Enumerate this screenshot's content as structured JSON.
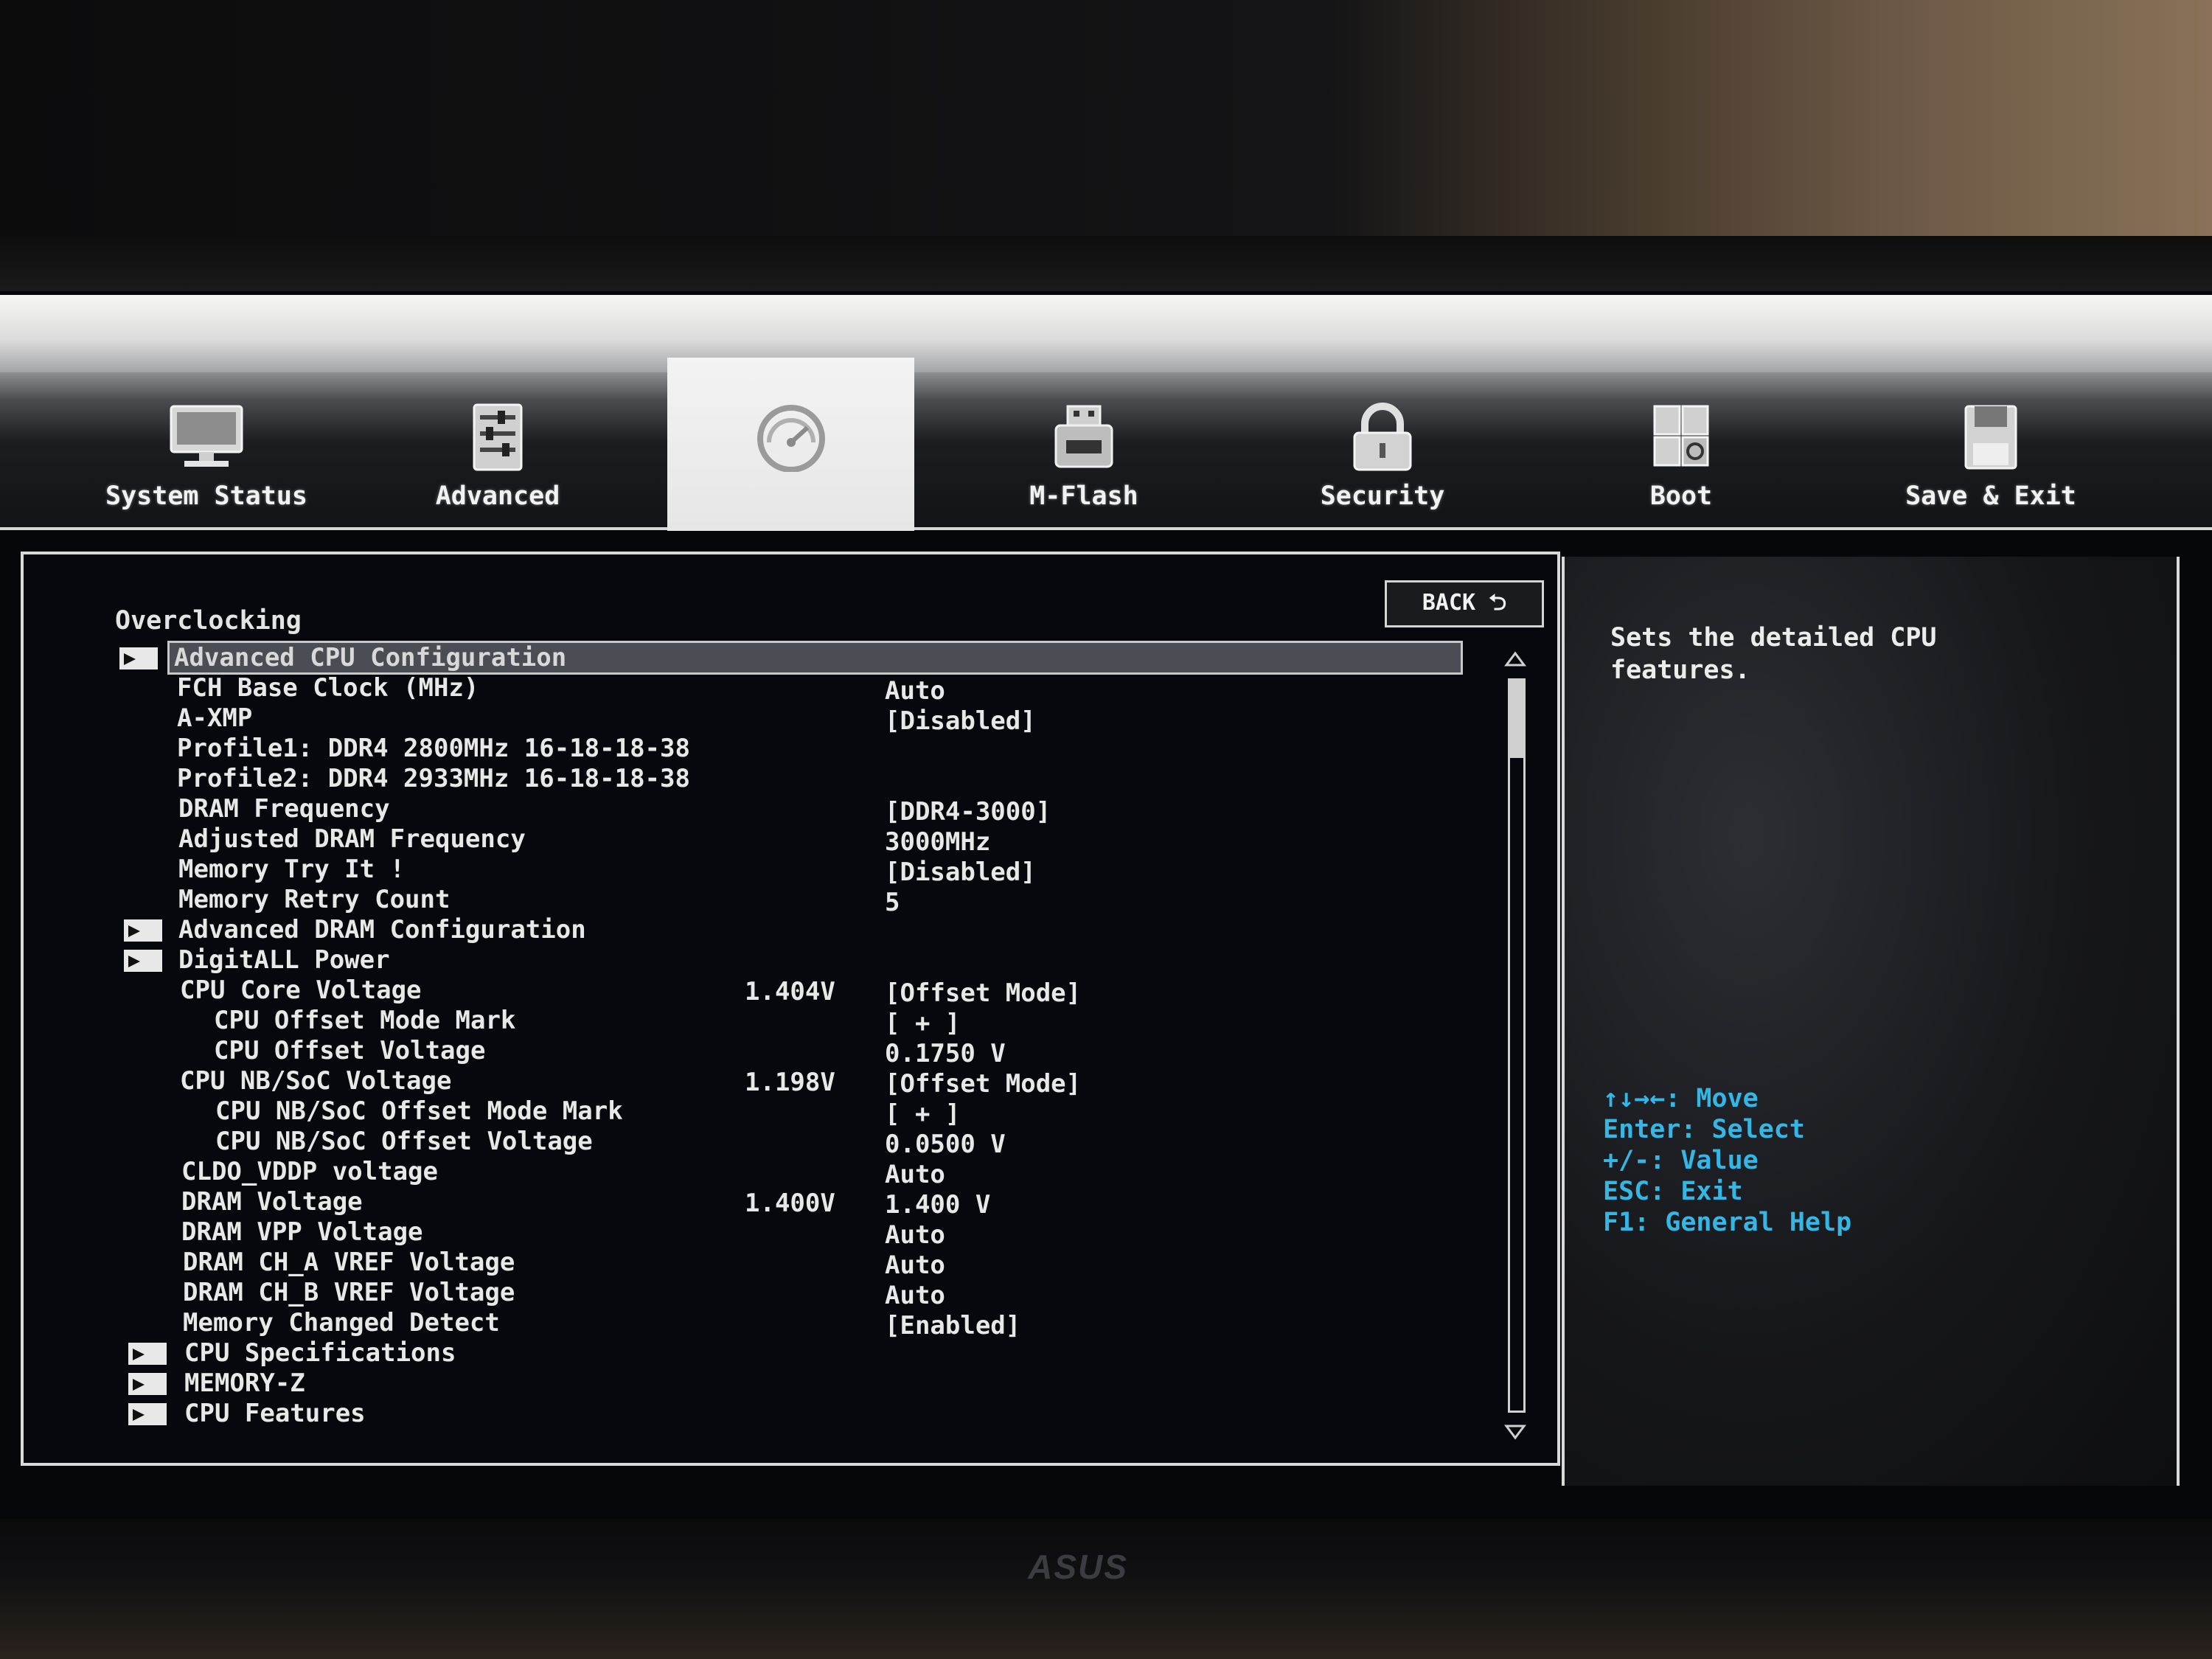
{
  "header": {
    "tabs": [
      {
        "label": "System Status",
        "icon": "monitor-icon"
      },
      {
        "label": "Advanced",
        "icon": "sliders-icon"
      },
      {
        "label": "",
        "icon": "gauge-icon",
        "active": true
      },
      {
        "label": "M-Flash",
        "icon": "usb-bios-icon"
      },
      {
        "label": "Security",
        "icon": "lock-icon"
      },
      {
        "label": "Boot",
        "icon": "boot-grid-icon"
      },
      {
        "label": "Save & Exit",
        "icon": "floppy-icon"
      }
    ]
  },
  "main": {
    "title": "Overclocking",
    "back_label": "BACK ⮌",
    "rows": [
      {
        "name": "Advanced CPU Configuration",
        "reading": "",
        "value": "",
        "folder": true,
        "selected": true,
        "indent": 0
      },
      {
        "name": "FCH Base Clock (MHz)",
        "reading": "",
        "value": "Auto",
        "indent": 0
      },
      {
        "name": "A-XMP",
        "reading": "",
        "value": "[Disabled]",
        "indent": 0
      },
      {
        "name": "Profile1: DDR4 2800MHz 16-18-18-38",
        "reading": "",
        "value": "",
        "indent": 0
      },
      {
        "name": "Profile2: DDR4 2933MHz 16-18-18-38",
        "reading": "",
        "value": "",
        "indent": 0
      },
      {
        "name": "DRAM Frequency",
        "reading": "",
        "value": "[DDR4-3000]",
        "indent": 0
      },
      {
        "name": "Adjusted DRAM Frequency",
        "reading": "",
        "value": "3000MHz",
        "indent": 0
      },
      {
        "name": "Memory Try It !",
        "reading": "",
        "value": "[Disabled]",
        "indent": 0
      },
      {
        "name": "Memory Retry Count",
        "reading": "",
        "value": "5",
        "indent": 0
      },
      {
        "name": "Advanced DRAM Configuration",
        "reading": "",
        "value": "",
        "folder": true,
        "indent": 0
      },
      {
        "name": "DigitALL Power",
        "reading": "",
        "value": "",
        "folder": true,
        "indent": 0
      },
      {
        "name": "CPU Core Voltage",
        "reading": "1.404V",
        "value": "[Offset Mode]",
        "indent": 0
      },
      {
        "name": "CPU Offset Mode Mark",
        "reading": "",
        "value": "[ + ]",
        "indent": 1
      },
      {
        "name": "CPU Offset Voltage",
        "reading": "",
        "value": "0.1750 V",
        "indent": 1
      },
      {
        "name": "CPU NB/SoC Voltage",
        "reading": "1.198V",
        "value": "[Offset Mode]",
        "indent": 0
      },
      {
        "name": "CPU NB/SoC Offset Mode Mark",
        "reading": "",
        "value": "[ + ]",
        "indent": 1
      },
      {
        "name": "CPU NB/SoC Offset Voltage",
        "reading": "",
        "value": "0.0500 V",
        "indent": 1
      },
      {
        "name": "CLDO_VDDP voltage",
        "reading": "",
        "value": "Auto",
        "indent": 0
      },
      {
        "name": "DRAM Voltage",
        "reading": "1.400V",
        "value": "1.400 V",
        "indent": 0
      },
      {
        "name": "DRAM VPP Voltage",
        "reading": "",
        "value": "Auto",
        "indent": 0
      },
      {
        "name": "DRAM CH_A VREF Voltage",
        "reading": "",
        "value": "Auto",
        "indent": 0
      },
      {
        "name": "DRAM CH_B VREF Voltage",
        "reading": "",
        "value": "Auto",
        "indent": 0
      },
      {
        "name": "Memory Changed Detect",
        "reading": "",
        "value": "[Enabled]",
        "indent": 0
      },
      {
        "name": "CPU Specifications",
        "reading": "",
        "value": "",
        "folder": true,
        "indent": 0
      },
      {
        "name": "MEMORY-Z",
        "reading": "",
        "value": "",
        "folder": true,
        "indent": 0
      },
      {
        "name": "CPU Features",
        "reading": "",
        "value": "",
        "folder": true,
        "indent": 0
      }
    ]
  },
  "help": {
    "description": "Sets the detailed CPU\nfeatures.",
    "keys": [
      "↑↓→←: Move",
      "Enter: Select",
      "+/-: Value",
      "ESC: Exit",
      "F1: General Help"
    ]
  },
  "monitor": {
    "brand": "ASUS"
  },
  "colors": {
    "key_help": "#35b7e6",
    "panel_border": "#d9d9d9",
    "selection": "#4b4d55"
  }
}
